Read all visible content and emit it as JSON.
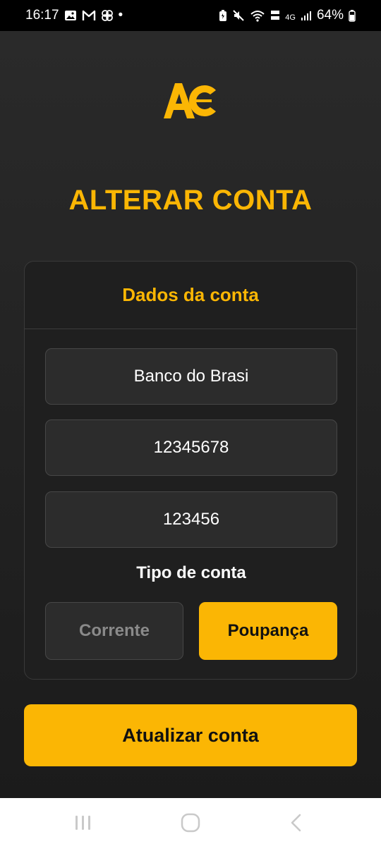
{
  "status_bar": {
    "time": "16:17",
    "dot": "•",
    "network_label": "4G",
    "battery_percent": "64%",
    "left_icons": [
      "gallery-icon",
      "gmail-icon",
      "pinwheel-icon"
    ],
    "right_icons": [
      "battery-saver-icon",
      "mute-icon",
      "wifi-icon",
      "volte-icon",
      "signal-icon",
      "battery-icon"
    ]
  },
  "app": {
    "logo_text": "AC",
    "title": "ALTERAR CONTA",
    "card": {
      "header": "Dados da conta",
      "fields": [
        {
          "value": "Banco do Brasi"
        },
        {
          "value": "12345678"
        },
        {
          "value": "123456"
        }
      ],
      "type_label": "Tipo de conta",
      "type_options": [
        "Corrente",
        "Poupança"
      ],
      "type_selected": "Poupança"
    },
    "submit_label": "Atualizar conta"
  },
  "colors": {
    "accent": "#fbb604",
    "background": "#1e1e1e",
    "field_bg": "#2c2c2c",
    "text": "#ffffff",
    "inactive_text": "#8a8a8a"
  },
  "nav_bar": {
    "icons": [
      "recent-apps-icon",
      "home-icon",
      "back-icon"
    ]
  }
}
